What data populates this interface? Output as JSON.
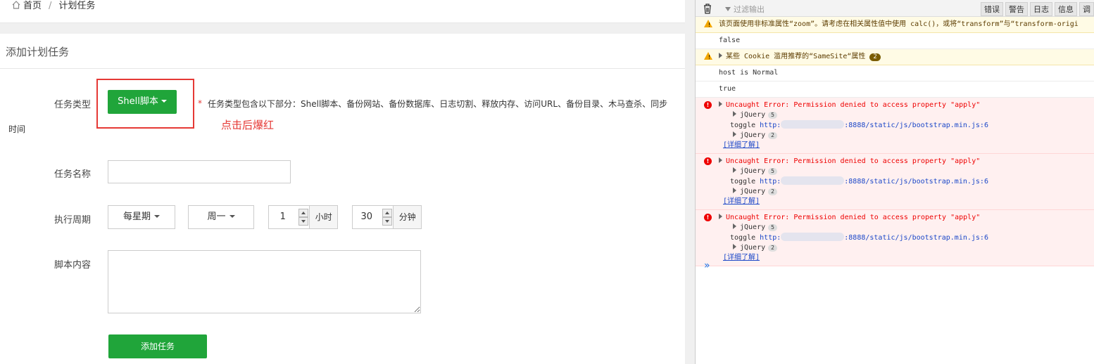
{
  "breadcrumb": {
    "home": "首页",
    "separator": "/",
    "current": "计划任务"
  },
  "panel": {
    "title": "添加计划任务"
  },
  "form": {
    "task_type_label": "任务类型",
    "task_type_value": "Shell脚本",
    "task_type_note_star": "*",
    "task_type_note": "任务类型包含以下部分：Shell脚本、备份网站、备份数据库、日志切割、释放内存、访问URL、备份目录、木马查杀、同步",
    "task_type_note_wrap": "时间",
    "annotation": "点击后爆红",
    "task_name_label": "任务名称",
    "task_name_value": "",
    "cycle_label": "执行周期",
    "cycle_value": "每星期",
    "weekday_value": "周一",
    "hour_value": "1",
    "hour_unit": "小时",
    "minute_value": "30",
    "minute_unit": "分钟",
    "script_label": "脚本内容",
    "script_value": "",
    "submit": "添加任务"
  },
  "console": {
    "filter_placeholder": "过滤输出",
    "levels": [
      "错误",
      "警告",
      "日志",
      "信息",
      "调"
    ],
    "messages": [
      {
        "type": "warn",
        "text": "该页面使用非标准属性“zoom”。请考虑在相关属性值中使用 calc()，或将“transform”与“transform-origi"
      },
      {
        "type": "log",
        "text": "false"
      },
      {
        "type": "warn",
        "text": "某些 Cookie 滥用推荐的“SameSite“属性",
        "count": "2"
      },
      {
        "type": "log",
        "text": "host is Normal"
      },
      {
        "type": "log",
        "text": "true"
      }
    ],
    "errors": [
      {
        "text": "Uncaught Error: Permission denied to access property \"apply\"",
        "line1": "jQuery",
        "count1": "5",
        "toggle": "toggle",
        "url_prefix": "http:",
        "url_suffix": ":8888/static/js/bootstrap.min.js:6",
        "line3": "jQuery",
        "count3": "2",
        "learn_more": "[详细了解]"
      },
      {
        "text": "Uncaught Error: Permission denied to access property \"apply\"",
        "line1": "jQuery",
        "count1": "5",
        "toggle": "toggle",
        "url_prefix": "http:",
        "url_suffix": ":8888/static/js/bootstrap.min.js:6",
        "line3": "jQuery",
        "count3": "2",
        "learn_more": "[详细了解]"
      },
      {
        "text": "Uncaught Error: Permission denied to access property \"apply\"",
        "line1": "jQuery",
        "count1": "5",
        "toggle": "toggle",
        "url_prefix": "http:",
        "url_suffix": ":8888/static/js/bootstrap.min.js:6",
        "line3": "jQuery",
        "count3": "2",
        "learn_more": "[详细了解]"
      }
    ],
    "prompt": "»"
  }
}
